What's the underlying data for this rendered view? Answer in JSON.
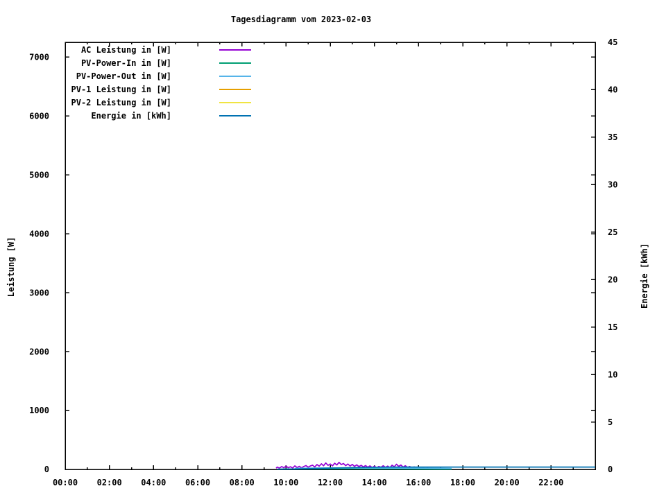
{
  "chart_data": {
    "type": "line",
    "title": "Tagesdiagramm vom 2023-02-03",
    "grid": false,
    "legend_position": "top-left-inside",
    "x_axis": {
      "unit": "time of day",
      "range": [
        0,
        24
      ],
      "major_tick_every_hours": 2,
      "minor_tick_every_hours": 1,
      "tick_labels": [
        "00:00",
        "02:00",
        "04:00",
        "06:00",
        "08:00",
        "10:00",
        "12:00",
        "14:00",
        "16:00",
        "18:00",
        "20:00",
        "22:00"
      ]
    },
    "y_left": {
      "label": "Leistung [W]",
      "range": [
        0,
        7250
      ],
      "ticks": [
        0,
        1000,
        2000,
        3000,
        4000,
        5000,
        6000,
        7000
      ]
    },
    "y_right": {
      "label": "Energie [kWh]",
      "range": [
        0,
        45
      ],
      "ticks": [
        0,
        5,
        10,
        15,
        20,
        25,
        30,
        35,
        40,
        45
      ]
    },
    "series": [
      {
        "name": "AC Leistung in [W]",
        "color": "#9400d3",
        "axis": "left",
        "points": [
          [
            9.55,
            20
          ],
          [
            9.6,
            40
          ],
          [
            9.7,
            22
          ],
          [
            9.8,
            48
          ],
          [
            9.9,
            28
          ],
          [
            10.0,
            55
          ],
          [
            10.1,
            30
          ],
          [
            10.2,
            45
          ],
          [
            10.3,
            25
          ],
          [
            10.4,
            60
          ],
          [
            10.5,
            32
          ],
          [
            10.6,
            52
          ],
          [
            10.7,
            28
          ],
          [
            10.8,
            48
          ],
          [
            10.9,
            65
          ],
          [
            11.0,
            38
          ],
          [
            11.1,
            58
          ],
          [
            11.2,
            72
          ],
          [
            11.3,
            42
          ],
          [
            11.4,
            82
          ],
          [
            11.5,
            55
          ],
          [
            11.6,
            95
          ],
          [
            11.7,
            62
          ],
          [
            11.8,
            110
          ],
          [
            11.9,
            70
          ],
          [
            12.0,
            92
          ],
          [
            12.1,
            60
          ],
          [
            12.2,
            105
          ],
          [
            12.3,
            75
          ],
          [
            12.4,
            120
          ],
          [
            12.5,
            82
          ],
          [
            12.6,
            100
          ],
          [
            12.7,
            65
          ],
          [
            12.8,
            92
          ],
          [
            12.9,
            58
          ],
          [
            13.0,
            85
          ],
          [
            13.1,
            52
          ],
          [
            13.2,
            78
          ],
          [
            13.3,
            48
          ],
          [
            13.4,
            70
          ],
          [
            13.5,
            42
          ],
          [
            13.6,
            65
          ],
          [
            13.7,
            38
          ],
          [
            13.8,
            60
          ],
          [
            13.9,
            32
          ],
          [
            14.0,
            55
          ],
          [
            14.1,
            28
          ],
          [
            14.2,
            50
          ],
          [
            14.3,
            38
          ],
          [
            14.4,
            62
          ],
          [
            14.5,
            34
          ],
          [
            14.6,
            56
          ],
          [
            14.7,
            30
          ],
          [
            14.8,
            72
          ],
          [
            14.9,
            45
          ],
          [
            15.0,
            88
          ],
          [
            15.1,
            52
          ],
          [
            15.2,
            75
          ],
          [
            15.3,
            40
          ],
          [
            15.4,
            62
          ],
          [
            15.5,
            34
          ],
          [
            15.6,
            50
          ],
          [
            15.7,
            25
          ],
          [
            15.8,
            42
          ],
          [
            15.9,
            20
          ],
          [
            16.0,
            35
          ],
          [
            16.1,
            14
          ],
          [
            16.2,
            26
          ],
          [
            16.3,
            10
          ],
          [
            16.4,
            20
          ],
          [
            16.5,
            8
          ],
          [
            16.6,
            15
          ],
          [
            16.7,
            5
          ],
          [
            16.8,
            12
          ],
          [
            16.9,
            4
          ],
          [
            17.0,
            10
          ],
          [
            17.1,
            3
          ],
          [
            17.2,
            5
          ]
        ]
      },
      {
        "name": "PV-Power-In in [W]",
        "color": "#009e73",
        "axis": "left",
        "points": [
          [
            9.6,
            4
          ],
          [
            10.0,
            7
          ],
          [
            11.0,
            8
          ],
          [
            12.0,
            10
          ],
          [
            13.0,
            9
          ],
          [
            14.0,
            8
          ],
          [
            15.0,
            8
          ],
          [
            16.0,
            6
          ],
          [
            17.0,
            5
          ],
          [
            17.5,
            4
          ]
        ]
      },
      {
        "name": "PV-Power-Out in [W]",
        "color": "#56b4e9",
        "axis": "left",
        "points": [
          [
            10.4,
            18
          ],
          [
            11.0,
            22
          ],
          [
            12.0,
            25
          ],
          [
            13.0,
            25
          ],
          [
            14.0,
            23
          ],
          [
            15.0,
            22
          ],
          [
            16.0,
            20
          ],
          [
            17.0,
            18
          ],
          [
            17.5,
            15
          ]
        ]
      },
      {
        "name": "PV-1 Leistung in [W]",
        "color": "#e69f00",
        "axis": "left",
        "points": []
      },
      {
        "name": "PV-2 Leistung in [W]",
        "color": "#f0e442",
        "axis": "left",
        "points": []
      },
      {
        "name": "Energie in [kWh]",
        "color": "#0072b2",
        "axis": "right",
        "points": [
          [
            9.6,
            0.02
          ],
          [
            10.5,
            0.05
          ],
          [
            11.5,
            0.11
          ],
          [
            12.5,
            0.17
          ],
          [
            13.5,
            0.21
          ],
          [
            14.5,
            0.24
          ],
          [
            15.5,
            0.25
          ],
          [
            24.0,
            0.25
          ]
        ]
      }
    ]
  }
}
